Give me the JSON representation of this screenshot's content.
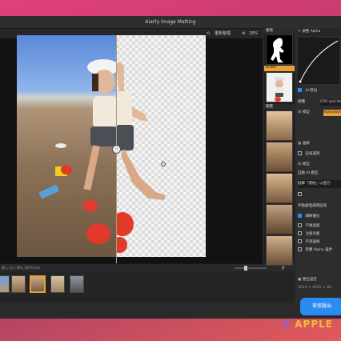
{
  "window": {
    "title": "Aiarty Image Matting"
  },
  "toolbar": {
    "reset_label": "重新整理",
    "zoom_label": "18%"
  },
  "canvas": {
    "split_handle_label": "‹›"
  },
  "status": {
    "path_text": "匯入 (1) | IMG_5876.heic",
    "zoom_slider_value": 0.4
  },
  "filmstrip": {
    "thumbnails": [
      "thumb-1",
      "thumb-2",
      "thumb-3",
      "thumb-4",
      "thumb-5"
    ],
    "selected_index": 2
  },
  "mask_column": {
    "header_label": "蒙版",
    "rgba_label": "RGBA",
    "section_label": "圖層",
    "tile_captions": [
      "",
      "",
      "AI 摳",
      "原始",
      "背景"
    ]
  },
  "panel": {
    "top_label": "調整 Alpha",
    "ai_section": "AI 匯出",
    "device_label": "硬體",
    "device_value": "CPU and Image",
    "model_label": "AI 模型",
    "model_value": "AlphaStyle",
    "edge_label": "邊緣",
    "region_label": "區域選擇",
    "ai_model2_label": "AI 模型",
    "auto_model_label": "自動 AI 模型",
    "tip_text": "點擊「開始」以進行",
    "manual_label": "手動處理選擇區域",
    "refine_label": "細節優化",
    "opts": [
      "不規遮擋",
      "注重毛髮",
      "平滑邊緣",
      "影響 Alpha 邊界"
    ],
    "output_label": "匯出設定",
    "output_value": "3024 × 4032 × 4K",
    "export_button": "單張匯出"
  },
  "watermark": {
    "text": "APPLE"
  }
}
